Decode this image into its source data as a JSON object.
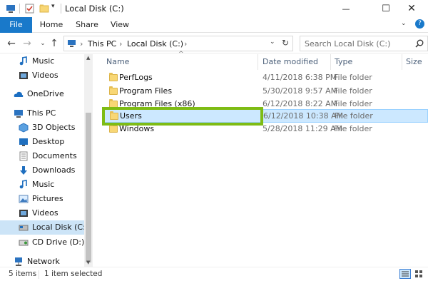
{
  "window": {
    "title": "Local Disk (C:)",
    "controls": {
      "minimize": "—",
      "maximize": "☐",
      "close": "✕"
    }
  },
  "ribbon": {
    "tabs": [
      "File",
      "Home",
      "Share",
      "View"
    ],
    "help_icon": "?"
  },
  "address": {
    "path": [
      "This PC",
      "Local Disk (C:)"
    ],
    "separator": "›",
    "search_placeholder": "Search Local Disk (C:)"
  },
  "nav": {
    "items": [
      {
        "label": "Music",
        "icon": "music-icon"
      },
      {
        "label": "Videos",
        "icon": "videos-icon"
      },
      {
        "label": "OneDrive",
        "icon": "onedrive-icon"
      },
      {
        "label": "This PC",
        "icon": "this-pc-icon"
      },
      {
        "label": "3D Objects",
        "icon": "3d-objects-icon"
      },
      {
        "label": "Desktop",
        "icon": "desktop-icon"
      },
      {
        "label": "Documents",
        "icon": "documents-icon"
      },
      {
        "label": "Downloads",
        "icon": "downloads-icon"
      },
      {
        "label": "Music",
        "icon": "music-icon"
      },
      {
        "label": "Pictures",
        "icon": "pictures-icon"
      },
      {
        "label": "Videos",
        "icon": "videos-icon"
      },
      {
        "label": "Local Disk (C:)",
        "icon": "drive-icon"
      },
      {
        "label": "CD Drive (D:) CC",
        "icon": "cd-drive-icon"
      },
      {
        "label": "Network",
        "icon": "network-icon"
      }
    ]
  },
  "columns": {
    "name": "Name",
    "date": "Date modified",
    "type": "Type",
    "size": "Size"
  },
  "files": [
    {
      "name": "PerfLogs",
      "date": "4/11/2018 6:38 PM",
      "type": "File folder"
    },
    {
      "name": "Program Files",
      "date": "5/30/2018 9:57 AM",
      "type": "File folder"
    },
    {
      "name": "Program Files (x86)",
      "date": "6/12/2018 8:22 AM",
      "type": "File folder"
    },
    {
      "name": "Users",
      "date": "6/12/2018 10:38 AM",
      "type": "File folder"
    },
    {
      "name": "Windows",
      "date": "5/28/2018 11:29 AM",
      "type": "File folder"
    }
  ],
  "status": {
    "count": "5 items",
    "selected": "1 item selected"
  },
  "colors": {
    "accent": "#1979ca",
    "selection": "#cce8ff",
    "highlight": "#7ebc14"
  }
}
